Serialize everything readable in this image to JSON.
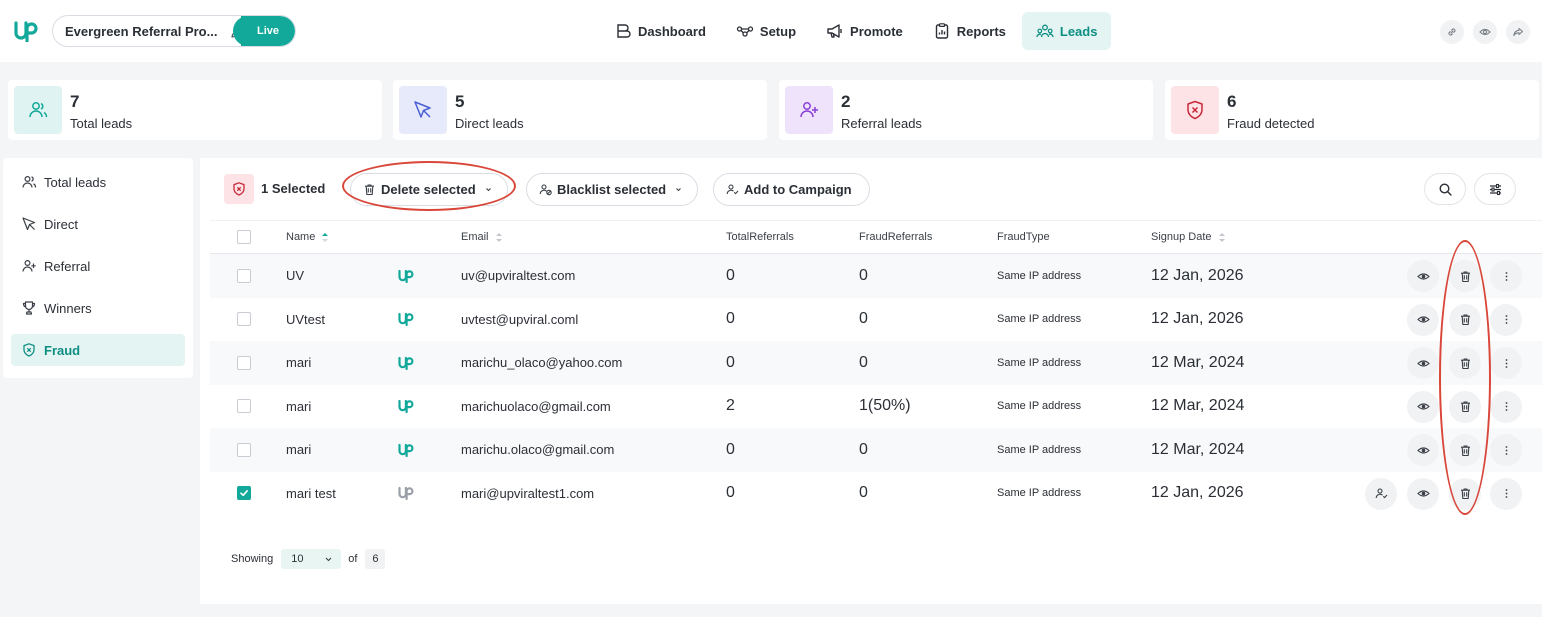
{
  "topbar": {
    "campaign_name": "Evergreen Referral Pro...",
    "status": "Live",
    "nav": [
      {
        "label": "Dashboard",
        "icon": "dashboard-icon"
      },
      {
        "label": "Setup",
        "icon": "setup-icon"
      },
      {
        "label": "Promote",
        "icon": "megaphone-icon"
      },
      {
        "label": "Reports",
        "icon": "report-icon"
      },
      {
        "label": "Leads",
        "icon": "users-icon",
        "active": true
      }
    ],
    "actions": [
      "link-icon",
      "eye-icon",
      "share-icon"
    ]
  },
  "stats": [
    {
      "value": "7",
      "label": "Total leads",
      "icon": "users-icon",
      "color": "#dff4f2"
    },
    {
      "value": "5",
      "label": "Direct leads",
      "icon": "cursor-icon",
      "color": "#e6eafb"
    },
    {
      "value": "2",
      "label": "Referral leads",
      "icon": "user-plus-icon",
      "color": "#efe3fb"
    },
    {
      "value": "6",
      "label": "Fraud detected",
      "icon": "shield-x-icon",
      "color": "#fde3e5"
    }
  ],
  "sidebar": {
    "items": [
      {
        "label": "Total leads",
        "icon": "users-icon"
      },
      {
        "label": "Direct",
        "icon": "cursor-icon"
      },
      {
        "label": "Referral",
        "icon": "user-plus-icon"
      },
      {
        "label": "Winners",
        "icon": "trophy-icon"
      },
      {
        "label": "Fraud",
        "icon": "shield-x-icon",
        "active": true
      }
    ]
  },
  "toolbar": {
    "selected_label": "1 Selected",
    "delete_label": "Delete selected",
    "blacklist_label": "Blacklist selected",
    "campaign_label": "Add to Campaign"
  },
  "table": {
    "headers": {
      "name": "Name",
      "email": "Email",
      "total_referrals": "TotalReferrals",
      "fraud_referrals": "FraudReferrals",
      "fraud_type": "FraudType",
      "signup_date": "Signup Date"
    },
    "rows": [
      {
        "checked": false,
        "name": "UV",
        "email": "uv@upviraltest.com",
        "total": "0",
        "fraud": "0",
        "type": "Same IP address",
        "date": "12 Jan, 2026",
        "muted_logo": false,
        "extra_action": false
      },
      {
        "checked": false,
        "name": "UVtest",
        "email": "uvtest@upviral.coml",
        "total": "0",
        "fraud": "0",
        "type": "Same IP address",
        "date": "12 Jan, 2026",
        "muted_logo": false,
        "extra_action": false
      },
      {
        "checked": false,
        "name": "mari",
        "email": "marichu_olaco@yahoo.com",
        "total": "0",
        "fraud": "0",
        "type": "Same IP address",
        "date": "12 Mar, 2024",
        "muted_logo": false,
        "extra_action": false
      },
      {
        "checked": false,
        "name": "mari",
        "email": "marichuolaco@gmail.com",
        "total": "2",
        "fraud": "1(50%)",
        "type": "Same IP address",
        "date": "12 Mar, 2024",
        "muted_logo": false,
        "extra_action": false
      },
      {
        "checked": false,
        "name": "mari",
        "email": "marichu.olaco@gmail.com",
        "total": "0",
        "fraud": "0",
        "type": "Same IP address",
        "date": "12 Mar, 2024",
        "muted_logo": false,
        "extra_action": false
      },
      {
        "checked": true,
        "name": "mari test",
        "email": "mari@upviraltest1.com",
        "total": "0",
        "fraud": "0",
        "type": "Same IP address",
        "date": "12 Jan, 2026",
        "muted_logo": true,
        "extra_action": true
      }
    ]
  },
  "pager": {
    "showing_label": "Showing",
    "per_page": "10",
    "of_label": "of",
    "total": "6"
  },
  "colors": {
    "accent": "#12a89a",
    "annotation": "#d9473a"
  }
}
